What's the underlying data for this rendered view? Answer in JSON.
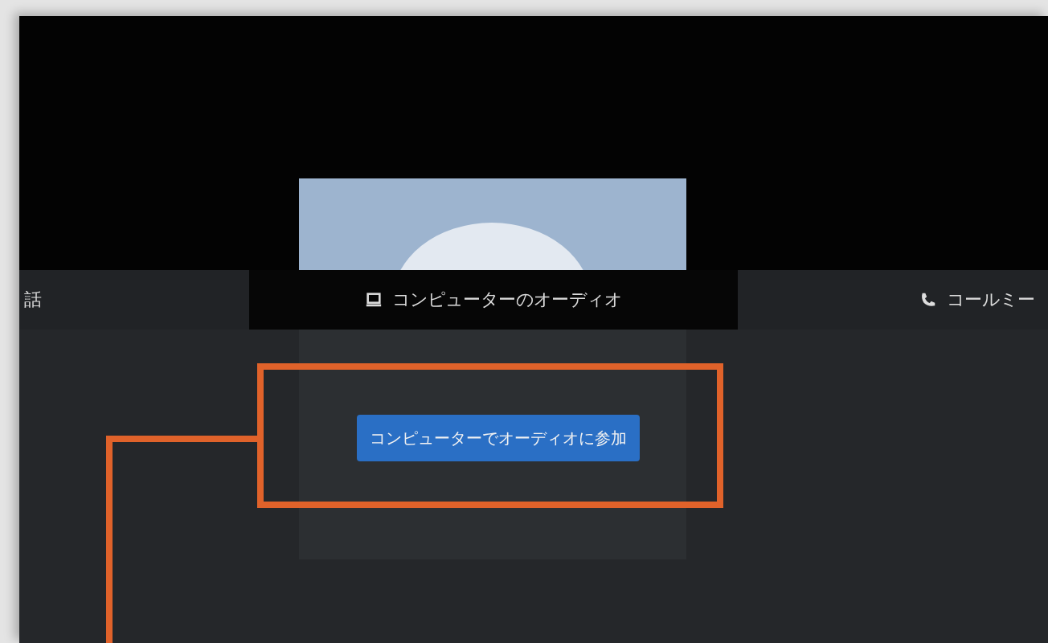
{
  "tabs": [
    {
      "label": "話",
      "kind": "plain",
      "selected": false
    },
    {
      "label": "コンピューターのオーディオ",
      "kind": "computer",
      "selected": true
    },
    {
      "label": "コールミー",
      "kind": "phone",
      "selected": false
    }
  ],
  "join_button": {
    "label": "コンピューターでオーディオに参加"
  }
}
